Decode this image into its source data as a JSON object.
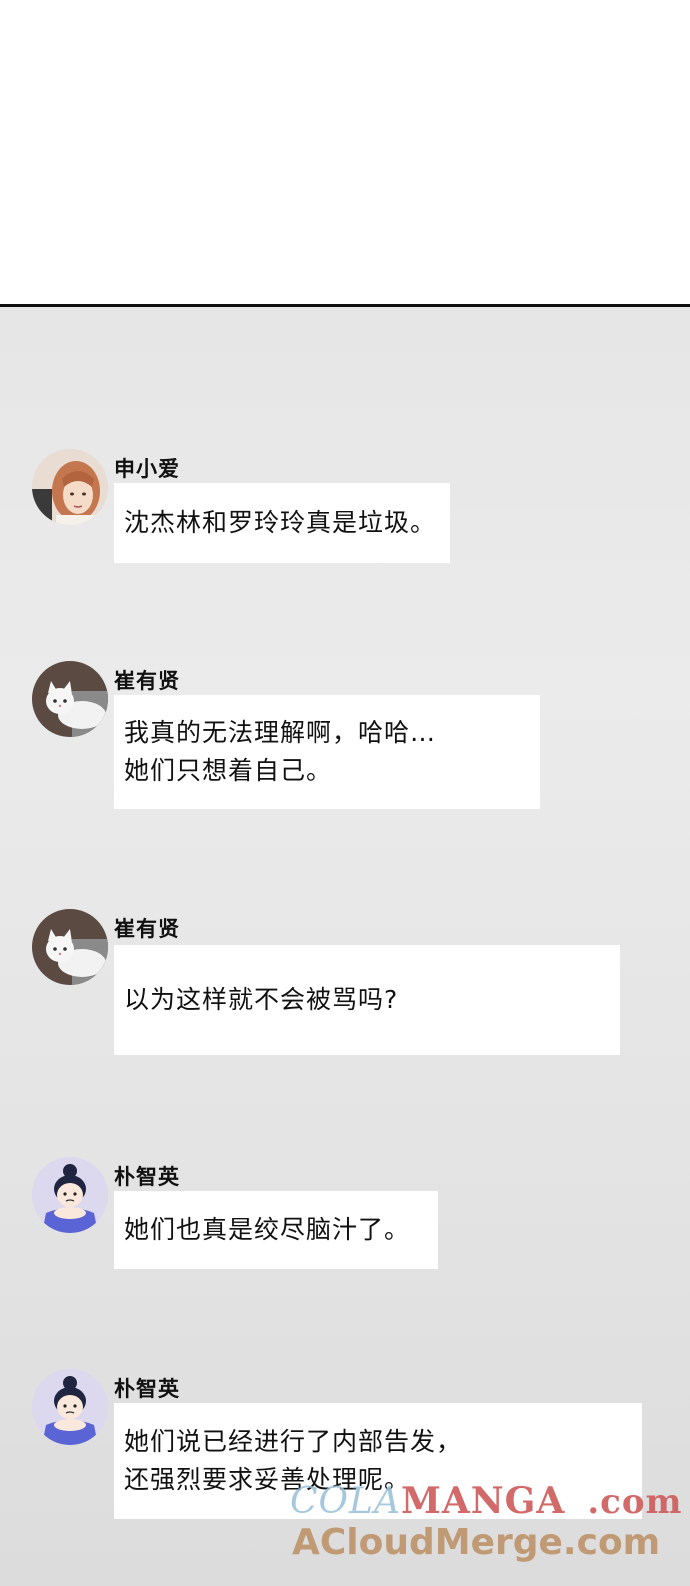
{
  "messages": [
    {
      "avatar": "woman-avatar-icon",
      "name": "申小爱",
      "lines": [
        "沈杰林和罗玲玲真是垃圾。"
      ]
    },
    {
      "avatar": "cat-avatar-icon",
      "name": "崔有贤",
      "lines": [
        "我真的无法理解啊，哈哈…",
        "她们只想着自己。"
      ]
    },
    {
      "avatar": "cat-avatar-icon",
      "name": "崔有贤",
      "lines": [
        "以为这样就不会被骂吗?"
      ]
    },
    {
      "avatar": "girl-avatar-icon",
      "name": "朴智英",
      "lines": [
        "她们也真是绞尽脑汁了。"
      ]
    },
    {
      "avatar": "girl-avatar-icon",
      "name": "朴智英",
      "lines": [
        "她们说已经进行了内部告发，",
        "还强烈要求妥善处理呢。"
      ]
    }
  ],
  "watermark": {
    "line1_part1": "COLA",
    "line1_part2": "MANGA",
    "line1_part3": ".com",
    "line2": "ACloudMerge.com"
  }
}
